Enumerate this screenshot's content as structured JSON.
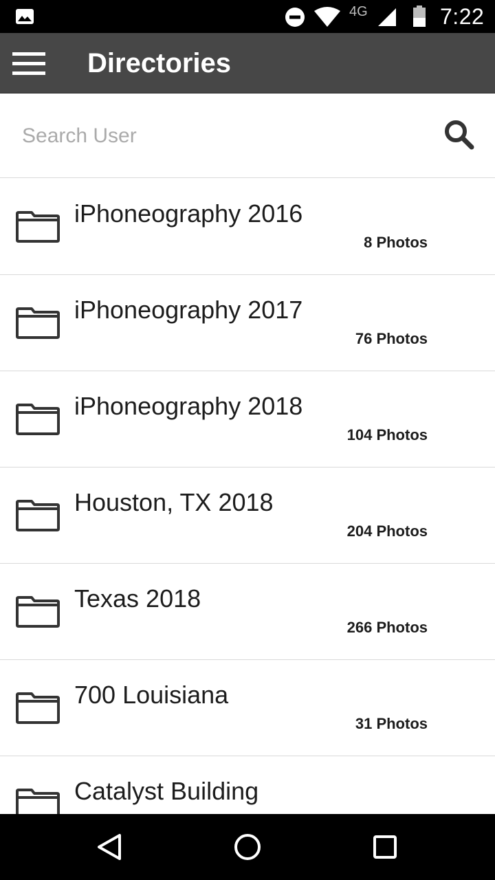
{
  "status_bar": {
    "time": "7:22",
    "network": "4G",
    "icons": [
      "image-notification-icon",
      "do-not-disturb-icon",
      "wifi-icon",
      "signal-icon",
      "battery-icon"
    ]
  },
  "app_bar": {
    "title": "Directories",
    "menu_icon": "hamburger-menu-icon",
    "background": "#474747"
  },
  "search": {
    "placeholder": "Search User",
    "value": "",
    "icon": "search-icon"
  },
  "directories": [
    {
      "name": "iPhoneography 2016",
      "count": "8 Photos"
    },
    {
      "name": "iPhoneography 2017",
      "count": "76 Photos"
    },
    {
      "name": "iPhoneography 2018",
      "count": "104 Photos"
    },
    {
      "name": "Houston, TX 2018",
      "count": "204 Photos"
    },
    {
      "name": "Texas 2018",
      "count": "266 Photos"
    },
    {
      "name": "700 Louisiana",
      "count": "31 Photos"
    },
    {
      "name": "Catalyst Building",
      "count": ""
    }
  ],
  "nav_bar": {
    "icons": [
      "back-icon",
      "home-icon",
      "recents-icon"
    ]
  }
}
